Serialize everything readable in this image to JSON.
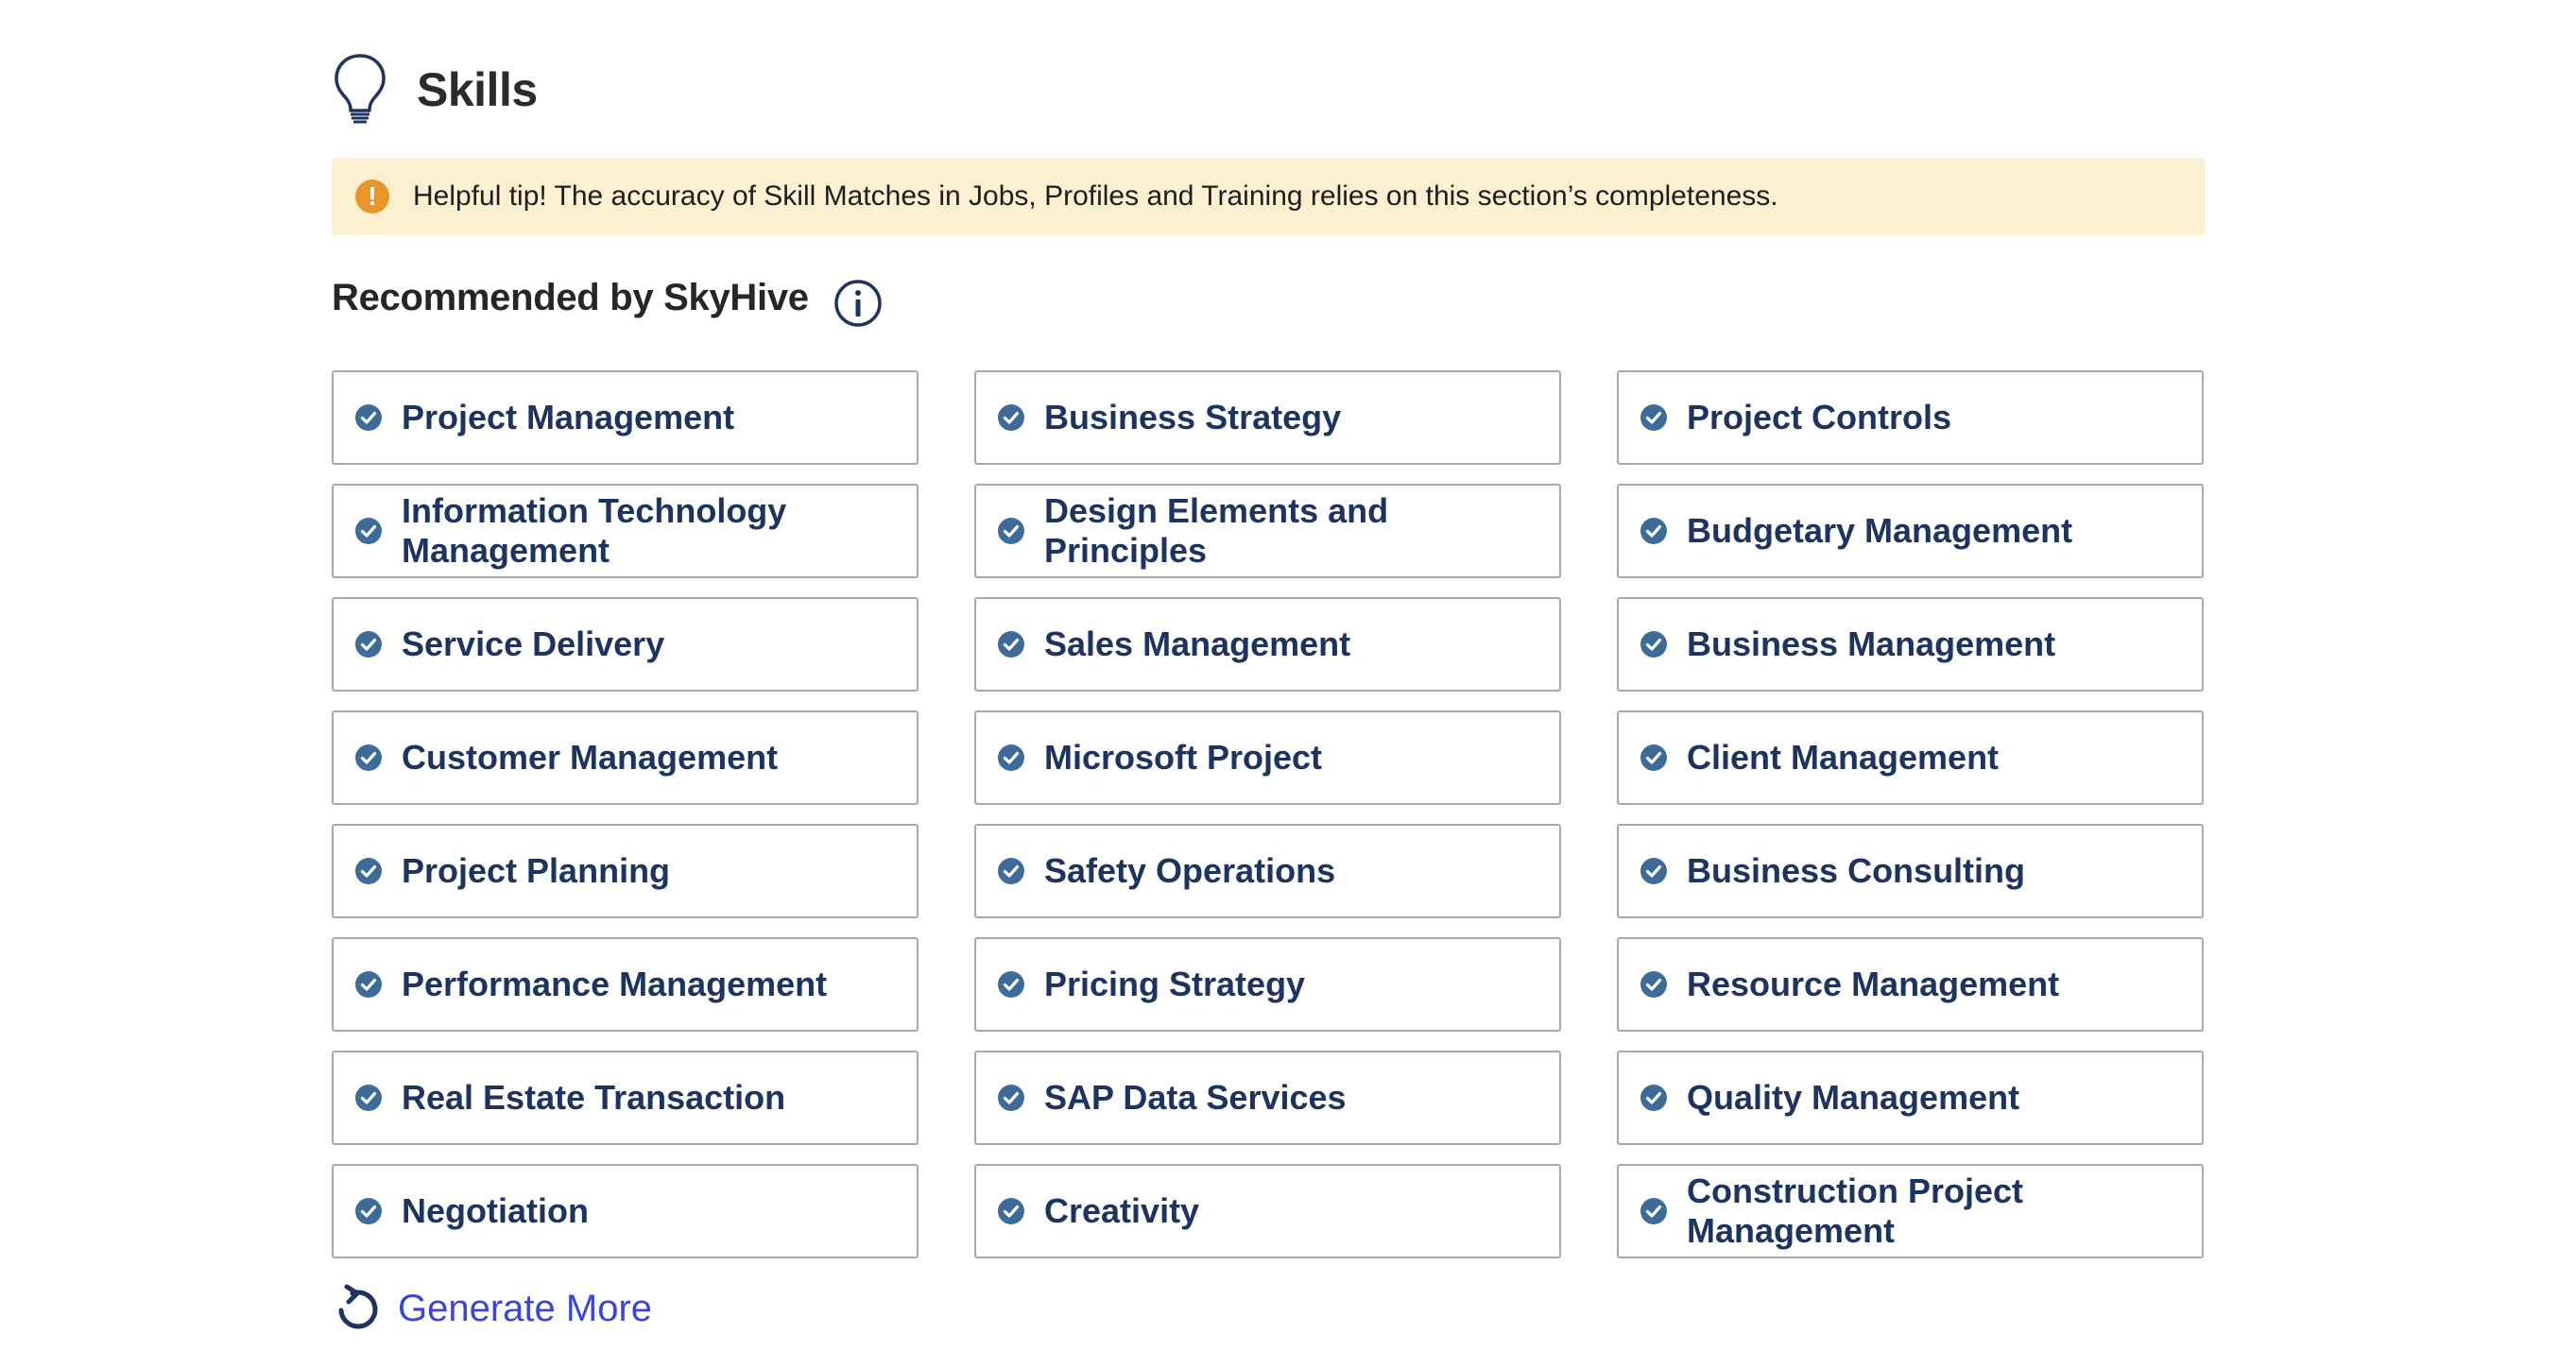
{
  "header": {
    "title": "Skills",
    "icon": "lightbulb-icon"
  },
  "tip": {
    "icon": "warning-icon",
    "icon_glyph": "!",
    "text": "Helpful tip! The accuracy of Skill Matches in Jobs, Profiles and Training relies on this section’s completeness."
  },
  "recommended": {
    "title": "Recommended by SkyHive",
    "info_icon": "info-icon"
  },
  "skills": [
    {
      "label": "Project Management",
      "selected": true
    },
    {
      "label": "Business Strategy",
      "selected": true
    },
    {
      "label": "Project Controls",
      "selected": true
    },
    {
      "label": "Information Technology Management",
      "selected": true
    },
    {
      "label": "Design Elements and Principles",
      "selected": true
    },
    {
      "label": "Budgetary Management",
      "selected": true
    },
    {
      "label": "Service Delivery",
      "selected": true
    },
    {
      "label": "Sales Management",
      "selected": true
    },
    {
      "label": "Business Management",
      "selected": true
    },
    {
      "label": "Customer Management",
      "selected": true
    },
    {
      "label": "Microsoft Project",
      "selected": true
    },
    {
      "label": "Client Management",
      "selected": true
    },
    {
      "label": "Project Planning",
      "selected": true
    },
    {
      "label": "Safety Operations",
      "selected": true
    },
    {
      "label": "Business Consulting",
      "selected": true
    },
    {
      "label": "Performance Management",
      "selected": true
    },
    {
      "label": "Pricing Strategy",
      "selected": true
    },
    {
      "label": "Resource Management",
      "selected": true
    },
    {
      "label": "Real Estate Transaction",
      "selected": true
    },
    {
      "label": "SAP Data Services",
      "selected": true
    },
    {
      "label": "Quality Management",
      "selected": true
    },
    {
      "label": "Negotiation",
      "selected": true
    },
    {
      "label": "Creativity",
      "selected": true
    },
    {
      "label": "Construction Project Management",
      "selected": true
    }
  ],
  "generate_more": {
    "label": "Generate More",
    "icon": "refresh-icon"
  },
  "colors": {
    "skill_text": "#1d3461",
    "check": "#3f6b98",
    "link": "#3a46d8",
    "tip_background": "#fbf0cf",
    "warning": "#e8962a"
  }
}
